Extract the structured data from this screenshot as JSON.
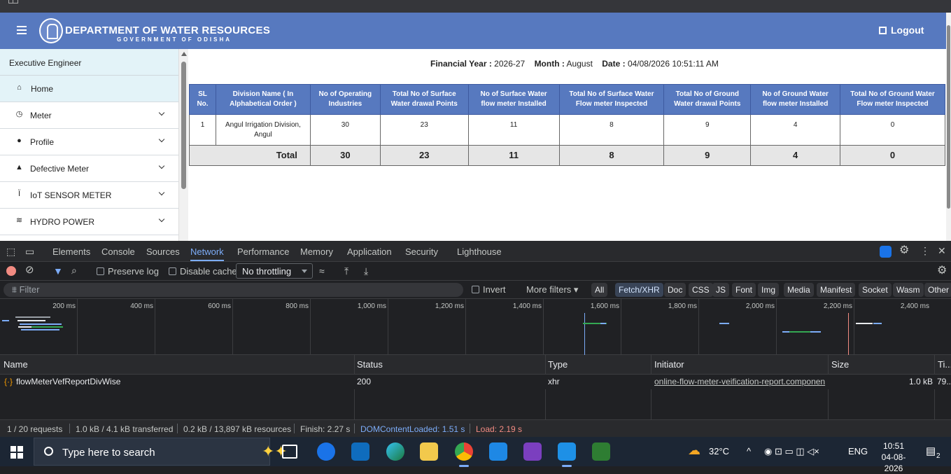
{
  "app": {
    "title": "DEPARTMENT OF WATER RESOURCES",
    "subtitle": "GOVERNMENT OF ODISHA",
    "logout_label": "Logout",
    "role": "Executive Engineer",
    "nav": [
      {
        "label": "Home",
        "icon": "home-icon"
      },
      {
        "label": "Meter",
        "icon": "meter-icon"
      },
      {
        "label": "Profile",
        "icon": "user-icon"
      },
      {
        "label": "Defective Meter",
        "icon": "warning-icon"
      },
      {
        "label": "IoT SENSOR METER",
        "icon": "sensor-icon"
      },
      {
        "label": "HYDRO POWER",
        "icon": "hydro-icon"
      }
    ],
    "report": {
      "fy_label": "Financial Year :",
      "fy_value": "2026-27",
      "month_label": "Month :",
      "month_value": "August",
      "date_label": "Date :",
      "date_value": "04/08/2026 10:51:11 AM",
      "headers": [
        "SL No.",
        "Division Name ( In Alphabetical Order )",
        "No of Operating Industries",
        "Total No of Surface Water drawal Points",
        "No of Surface Water flow meter Installed",
        "Total No of Surface Water Flow meter Inspected",
        "Total No of Ground Water drawal Points",
        "No of Ground Water flow meter Installed",
        "Total No of Ground Water Flow meter Inspected"
      ],
      "rows": [
        [
          "1",
          "Angul Irrigation Division, Angul",
          "30",
          "23",
          "11",
          "8",
          "9",
          "4",
          "0"
        ]
      ],
      "total_label": "Total",
      "totals": [
        "30",
        "23",
        "11",
        "8",
        "9",
        "4",
        "0"
      ]
    }
  },
  "devtools": {
    "tabs": [
      "Elements",
      "Console",
      "Sources",
      "Network",
      "Performance",
      "Memory",
      "Application",
      "Security",
      "Lighthouse"
    ],
    "active_tab": "Network",
    "preserve_log": "Preserve log",
    "disable_cache": "Disable cache",
    "throttling": "No throttling",
    "filter_placeholder": "Filter",
    "invert": "Invert",
    "more_filters": "More filters",
    "type_filters": [
      "All",
      "Fetch/XHR",
      "Doc",
      "CSS",
      "JS",
      "Font",
      "Img",
      "Media",
      "Manifest",
      "Socket",
      "Wasm",
      "Other"
    ],
    "selected_filter": "Fetch/XHR",
    "timeline_ticks": [
      "200 ms",
      "400 ms",
      "600 ms",
      "800 ms",
      "1,000 ms",
      "1,200 ms",
      "1,400 ms",
      "1,600 ms",
      "1,800 ms",
      "2,000 ms",
      "2,200 ms",
      "2,400 ms"
    ],
    "columns": [
      "Name",
      "Status",
      "Type",
      "Initiator",
      "Size",
      "Ti..."
    ],
    "requests": [
      {
        "name": "flowMeterVefReportDivWise",
        "status": "200",
        "type": "xhr",
        "initiator": "online-flow-meter-veification-report.componen",
        "size": "1.0 kB",
        "time": "79..."
      }
    ],
    "status": {
      "requests": "1 / 20 requests",
      "transferred": "1.0 kB / 4.1 kB transferred",
      "resources": "0.2 kB / 13,897 kB resources",
      "finish": "Finish: 2.27 s",
      "dcl": "DOMContentLoaded: 1.51 s",
      "load": "Load: 2.19 s"
    }
  },
  "taskbar": {
    "search_placeholder": "Type here to search",
    "weather": "32°C",
    "lang": "ENG",
    "time": "10:51",
    "date": "04-08-2026",
    "notif_count": "2"
  }
}
